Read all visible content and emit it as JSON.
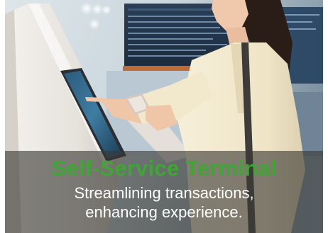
{
  "caption": {
    "title": "Self-Service Terminal",
    "subtitle_line1": "Streamlining transactions,",
    "subtitle_line2": "enhancing experience."
  },
  "colors": {
    "title": "#3fa535",
    "subtitle": "#ffffff",
    "overlay": "#3a3834"
  }
}
